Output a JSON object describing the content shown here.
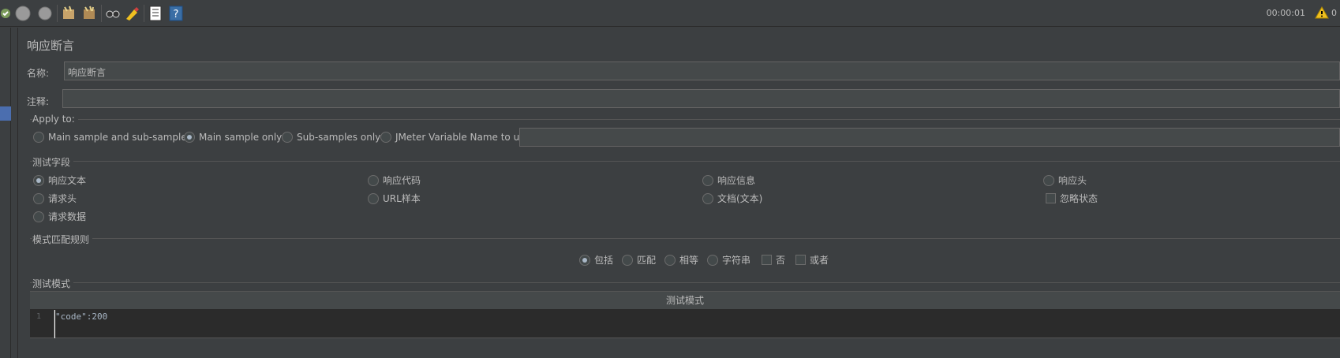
{
  "toolbar": {
    "icons": [
      "remote-start-icon",
      "stop-icon",
      "shutdown-icon",
      "clear-icon",
      "clear-all-icon",
      "search-icon",
      "reset-search-icon",
      "function-helper-icon",
      "help-icon"
    ],
    "timer": "00:00:01",
    "warning_count": "0"
  },
  "panel": {
    "title": "响应断言",
    "name_label": "名称:",
    "name_value": "响应断言",
    "comment_label": "注释:",
    "comment_value": ""
  },
  "apply_to": {
    "legend": "Apply to:",
    "options": [
      "Main sample and sub-samples",
      "Main sample only",
      "Sub-samples only",
      "JMeter Variable Name to use"
    ],
    "selected": "Main sample only",
    "variable_value": ""
  },
  "test_field": {
    "legend": "测试字段",
    "options": [
      "响应文本",
      "响应代码",
      "响应信息",
      "响应头",
      "请求头",
      "URL样本",
      "文档(文本)",
      "忽略状态",
      "请求数据"
    ],
    "selected": "响应文本"
  },
  "pattern_rules": {
    "legend": "模式匹配规则",
    "radios": [
      "包括",
      "匹配",
      "相等",
      "字符串"
    ],
    "checks": [
      "否",
      "或者"
    ],
    "selected": "包括"
  },
  "test_patterns": {
    "legend": "测试模式",
    "column_header": "测试模式",
    "rows": [
      {
        "line": "1",
        "text": "\"code\":200"
      }
    ]
  }
}
